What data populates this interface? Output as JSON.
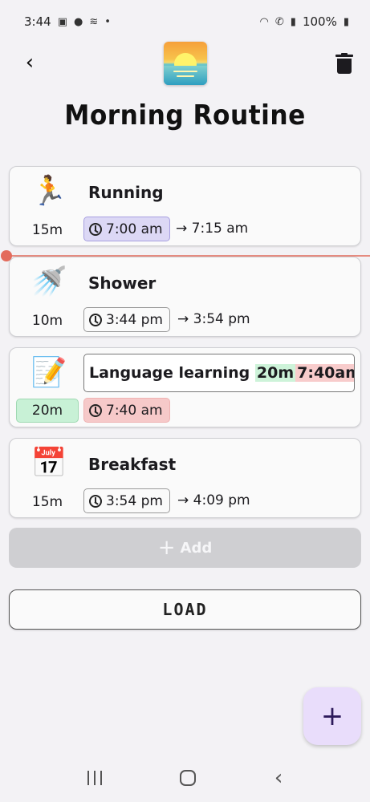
{
  "status_bar": {
    "time": "3:44",
    "battery": "100%"
  },
  "header": {
    "back_icon": "back-arrow-icon",
    "logo_icon": "sunrise-logo-icon",
    "delete_icon": "trash-icon"
  },
  "title": "Morning Routine",
  "tasks": [
    {
      "emoji": "🏃",
      "name": "Running",
      "duration": "15m",
      "start": "7:00 am",
      "end": "→ 7:15 am"
    },
    {
      "emoji": "🚿",
      "name": "Shower",
      "duration": "10m",
      "start": "3:44 pm",
      "end": "→ 3:54 pm"
    },
    {
      "emoji": "📝",
      "name_prefix": "Language learning ",
      "name_duration": "20m",
      "name_time": "7:40am",
      "duration": "20m",
      "start": "7:40 am"
    },
    {
      "emoji": "📅",
      "name": "Breakfast",
      "duration": "15m",
      "start": "3:54 pm",
      "end": "→ 4:09 pm"
    }
  ],
  "add_button": {
    "icon": "+",
    "label": "Add"
  },
  "load_button": {
    "label": "LOAD"
  },
  "fab": {
    "icon": "+"
  },
  "colors": {
    "accent_purple": "#dcd8f5",
    "warning_red": "#f6c9c9",
    "success_green": "#c8f1d6",
    "now_line": "#e36b5c"
  }
}
